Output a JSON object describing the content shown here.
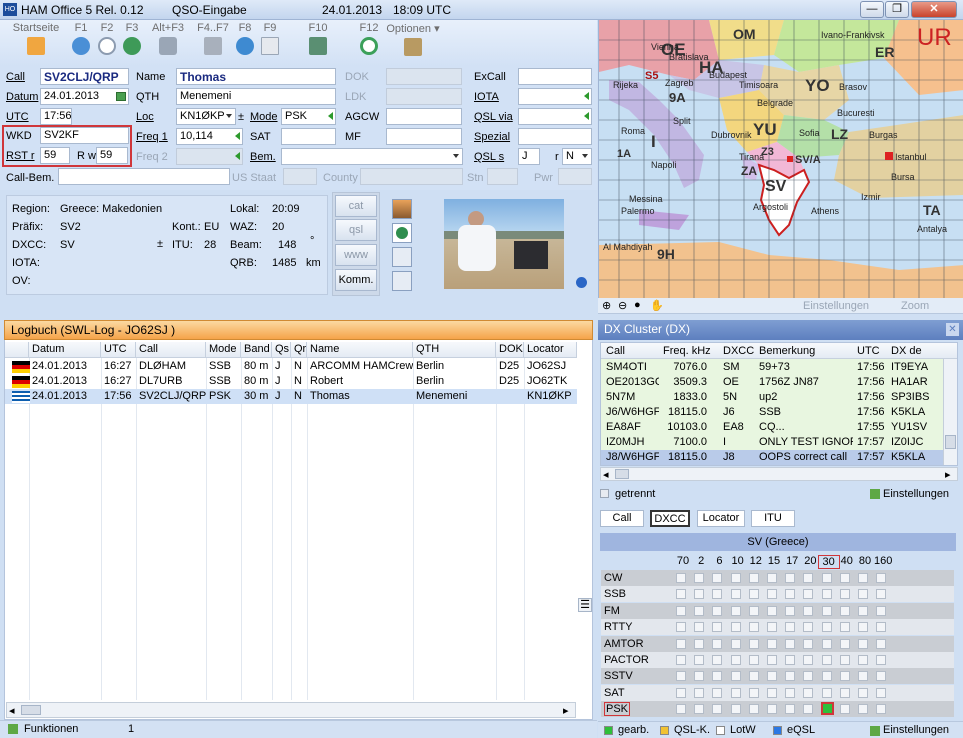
{
  "window": {
    "title": "HAM Office 5  Rel. 0.12",
    "section": "QSO-Eingabe",
    "date": "24.01.2013",
    "time": "18:09 UTC",
    "minimize": "—",
    "maximize": "❐",
    "close": "✕"
  },
  "toolbar": [
    {
      "key": "Startseite",
      "icon": "home-icon"
    },
    {
      "key": "F1",
      "icon": "help-icon"
    },
    {
      "key": "F2",
      "icon": "clock-icon"
    },
    {
      "key": "F3",
      "icon": "globe-icon"
    },
    {
      "key": "Alt+F3",
      "icon": "satellite-icon"
    },
    {
      "key": "F4..F7",
      "icon": "antenna-icon"
    },
    {
      "key": "F8",
      "icon": "globe-gear-icon"
    },
    {
      "key": "F9",
      "icon": "qsl-card-icon"
    },
    {
      "key": "F10",
      "icon": "save-icon"
    },
    {
      "key": "F12",
      "icon": "refresh-icon"
    },
    {
      "key": "Optionen",
      "icon": "tools-icon"
    }
  ],
  "form": {
    "call_label": "Call",
    "call": "SV2CLJ/QRP",
    "datum_label": "Datum",
    "datum": "24.01.2013",
    "utc_label": "UTC",
    "utc": "17:56",
    "wkd_label": "WKD",
    "wkd": "SV2KF",
    "rst_label": "RST r",
    "rst_r": "59",
    "rst_w_label": "R w",
    "rst_w": "59",
    "callbem_label": "Call-Bem.",
    "name_label": "Name",
    "name": "Thomas",
    "qth_label": "QTH",
    "qth": "Menemeni",
    "loc_label": "Loc",
    "loc": "KN1ØKP",
    "mode_label": "Mode",
    "mode": "PSK",
    "freq1_label": "Freq 1",
    "freq1": "10,114",
    "freq2_label": "Freq 2",
    "sat_label": "SAT",
    "bem_label": "Bem.",
    "dok_label": "DOK",
    "ldk_label": "LDK",
    "agcw_label": "AGCW",
    "mf_label": "MF",
    "excall_label": "ExCall",
    "iota_label": "IOTA",
    "qslvia_label": "QSL via",
    "spezial_label": "Spezial",
    "qsls_label": "QSL s",
    "qsls": "J",
    "qslr_label": "r",
    "qslr": "N",
    "usstaat_label": "US Staat",
    "county_label": "County",
    "stn_label": "Stn",
    "pwr_label": "Pwr"
  },
  "info": {
    "region_label": "Region:",
    "region": "Greece: Makedonien",
    "prafix_label": "Präfix:",
    "prafix": "SV2",
    "kont_label": "Kont.:",
    "kont": "EU",
    "dxcc_label": "DXCC:",
    "dxcc": "SV",
    "itu_label": "ITU:",
    "itu": "28",
    "iota_label": "IOTA:",
    "ov_label": "OV:",
    "lokal_label": "Lokal:",
    "lokal": "20:09",
    "waz_label": "WAZ:",
    "waz": "20",
    "beam_label": "Beam:",
    "beam": "148",
    "beam_unit": "°",
    "qrb_label": "QRB:",
    "qrb": "1485",
    "qrb_unit": "km"
  },
  "sidebuttons": {
    "cat": "cat",
    "qsl": "qsl",
    "www": "www",
    "komm": "Komm."
  },
  "logbook": {
    "title": "Logbuch  (SWL-Log - JO62SJ )",
    "columns": [
      "Datum",
      "UTC",
      "Call",
      "Mode",
      "Band",
      "Qs",
      "Qr",
      "Name",
      "QTH",
      "DOK",
      "Locator"
    ],
    "rows": [
      {
        "flag": "de",
        "cells": [
          "24.01.2013",
          "16:27",
          "DLØHAM",
          "SSB",
          "80 m",
          "J",
          "N",
          "ARCOMM HAMCrew",
          "Berlin",
          "D25",
          "JO62SJ"
        ]
      },
      {
        "flag": "de",
        "cells": [
          "24.01.2013",
          "16:27",
          "DL7URB",
          "SSB",
          "80 m",
          "J",
          "N",
          "Robert",
          "Berlin",
          "D25",
          "JO62TK"
        ]
      },
      {
        "flag": "gr",
        "cells": [
          "24.01.2013",
          "17:56",
          "SV2CLJ/QRP",
          "PSK",
          "30 m",
          "J",
          "N",
          "Thomas",
          "Menemeni",
          "",
          "KN1ØKP"
        ]
      }
    ]
  },
  "status": {
    "funktionen": "Funktionen",
    "count": "1"
  },
  "map": {
    "labels": [
      "OE",
      "OM",
      "HA",
      "ER",
      "UR",
      "S5",
      "9A",
      "YO",
      "YU",
      "LZ",
      "Z3",
      "SV/A",
      "ZA",
      "SV",
      "1A",
      "I",
      "9H",
      "TA"
    ],
    "places": [
      "Vienna",
      "Bratislava",
      "Budapest",
      "Ivano-Frankivsk",
      "Rijeka",
      "Zagreb",
      "Timisoara",
      "Brasov",
      "Belgrade",
      "Bucuresti",
      "Split",
      "Dubrovnik",
      "Sofia",
      "Burgas",
      "Roma",
      "Napoli",
      "Tirana",
      "Istanbul",
      "Bursa",
      "Messina",
      "Palermo",
      "Athens",
      "Izmir",
      "Antalya",
      "Al Mahdiyah",
      "Argostoli"
    ],
    "einstellungen": "Einstellungen",
    "zoom": "Zoom"
  },
  "dxcluster": {
    "title": "DX Cluster (DX)",
    "columns": [
      "Call",
      "Freq. kHz",
      "DXCC",
      "Bemerkung",
      "UTC",
      "DX de"
    ],
    "rows": [
      [
        "SM4OTI",
        "7076.0",
        "SM",
        "59+73",
        "17:56",
        "IT9EYA"
      ],
      [
        "OE2013GO",
        "3509.3",
        "OE",
        "1756Z JN87",
        "17:56",
        "HA1AR"
      ],
      [
        "5N7M",
        "1833.0",
        "5N",
        "up2",
        "17:56",
        "SP3IBS"
      ],
      [
        "J6/W6HGF",
        "18115.0",
        "J6",
        "SSB",
        "17:56",
        "K5KLA"
      ],
      [
        "EA8AF",
        "10103.0",
        "EA8",
        "CQ...",
        "17:55",
        "YU1SV"
      ],
      [
        "IZ0MJH",
        "7100.0",
        "I",
        "ONLY TEST IGNOF",
        "17:57",
        "IZ0IJC"
      ],
      [
        "J8/W6HGF",
        "18115.0",
        "J8",
        "OOPS correct call",
        "17:57",
        "K5KLA"
      ]
    ],
    "status": "getrennt",
    "einstellungen": "Einstellungen"
  },
  "dxcc_tabs": [
    "Call",
    "DXCC",
    "Locator",
    "ITU"
  ],
  "band_matrix": {
    "title": "SV (Greece)",
    "bands": [
      "70",
      "2",
      "6",
      "10",
      "12",
      "15",
      "17",
      "20",
      "30",
      "40",
      "80",
      "160"
    ],
    "modes": [
      "CW",
      "SSB",
      "FM",
      "RTTY",
      "AMTOR",
      "PACTOR",
      "SSTV",
      "SAT",
      "PSK"
    ],
    "highlight_band": "30",
    "highlight_mode": "PSK"
  },
  "legend": [
    {
      "label": "gearb.",
      "color": "#2ebf3a"
    },
    {
      "label": "QSL-K.",
      "color": "#f1c232"
    },
    {
      "label": "LotW",
      "color": "#ffffff"
    },
    {
      "label": "eQSL",
      "color": "#2b78e4"
    }
  ],
  "legend_settings": "Einstellungen"
}
